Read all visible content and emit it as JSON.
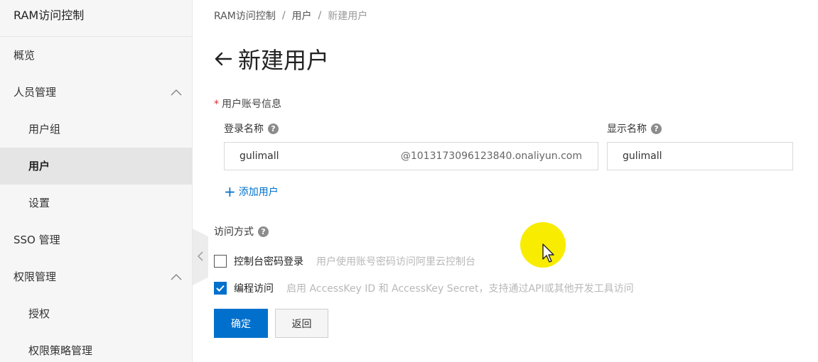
{
  "sidebar": {
    "title": "RAM访问控制",
    "items": [
      {
        "label": "概览"
      },
      {
        "label": "人员管理"
      },
      {
        "label": "用户组"
      },
      {
        "label": "用户"
      },
      {
        "label": "设置"
      },
      {
        "label": "SSO 管理"
      },
      {
        "label": "权限管理"
      },
      {
        "label": "授权"
      },
      {
        "label": "权限策略管理"
      }
    ]
  },
  "breadcrumb": [
    "RAM访问控制",
    "用户",
    "新建用户"
  ],
  "breadcrumb_separator": "/",
  "page": {
    "title": "新建用户"
  },
  "form": {
    "account_section_label": "用户账号信息",
    "required_mark": "*",
    "login_name": {
      "label": "登录名称",
      "value": "gulimall",
      "suffix": "@1013173096123840.onaliyun.com"
    },
    "display_name": {
      "label": "显示名称",
      "value": "gulimall"
    },
    "add_user_label": "添加用户",
    "access_section_label": "访问方式",
    "access_options": [
      {
        "label": "控制台密码登录",
        "description": "用户使用账号密码访问阿里云控制台",
        "checked": false
      },
      {
        "label": "编程访问",
        "description": "启用 AccessKey ID 和 AccessKey Secret，支持通过API或其他开发工具访问",
        "checked": true
      }
    ],
    "confirm_label": "确定",
    "back_label": "返回"
  },
  "colors": {
    "primary": "#0070cc",
    "required": "#e0282e",
    "cursor_highlight": "#f8ec00"
  }
}
